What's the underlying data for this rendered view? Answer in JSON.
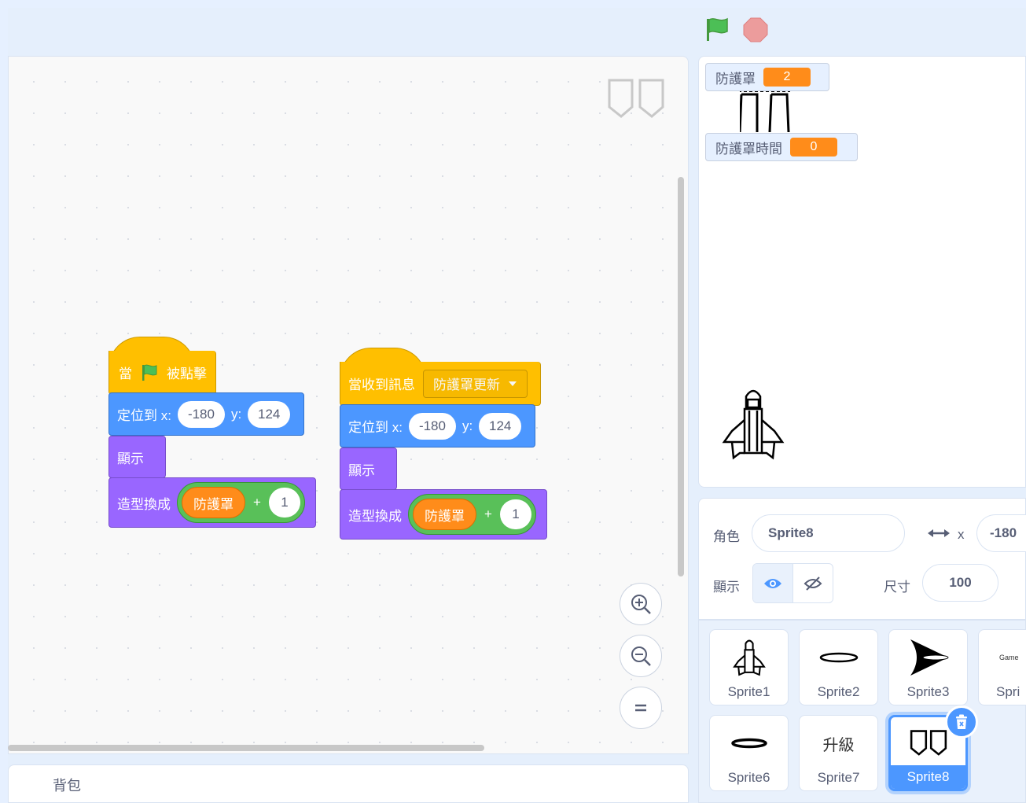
{
  "blocks": {
    "stack1": {
      "when": "當",
      "clicked": "被點擊",
      "goto_label": "定位到 x:",
      "x_value": "-180",
      "y_label": "y:",
      "y_value": "124",
      "show": "顯示",
      "switch_costume": "造型換成",
      "variable": "防護罩",
      "plus": "+",
      "number": "1"
    },
    "stack2": {
      "when_receive": "當收到訊息",
      "message": "防護罩更新",
      "goto_label": "定位到 x:",
      "x_value": "-180",
      "y_label": "y:",
      "y_value": "124",
      "show": "顯示",
      "switch_costume": "造型換成",
      "variable": "防護罩",
      "plus": "+",
      "number": "1"
    }
  },
  "backpack": {
    "label": "背包"
  },
  "stage": {
    "monitors": [
      {
        "name": "防護罩",
        "value": "2"
      },
      {
        "name": "防護罩時間",
        "value": "0"
      }
    ]
  },
  "sprite_info": {
    "sprite_label": "角色",
    "sprite_name": "Sprite8",
    "x_label": "x",
    "x_value": "-180",
    "show_label": "顯示",
    "size_label": "尺寸",
    "size_value": "100"
  },
  "sprites": [
    {
      "name": "Sprite1",
      "icon": "jet-icon"
    },
    {
      "name": "Sprite2",
      "icon": "ellipse-icon"
    },
    {
      "name": "Sprite3",
      "icon": "arrow-shape-icon"
    },
    {
      "name": "Spri",
      "icon": "game-text-icon",
      "icon_text": "Game"
    },
    {
      "name": "Sprite6",
      "icon": "oval-icon"
    },
    {
      "name": "Sprite7",
      "icon": "text-icon",
      "icon_text": "升級"
    },
    {
      "name": "Sprite8",
      "icon": "shield-icon",
      "selected": true
    }
  ],
  "colors": {
    "event": "#ffbf00",
    "motion": "#4c97ff",
    "looks": "#9966ff",
    "variable": "#ff8c1a",
    "operator": "#59c059"
  }
}
